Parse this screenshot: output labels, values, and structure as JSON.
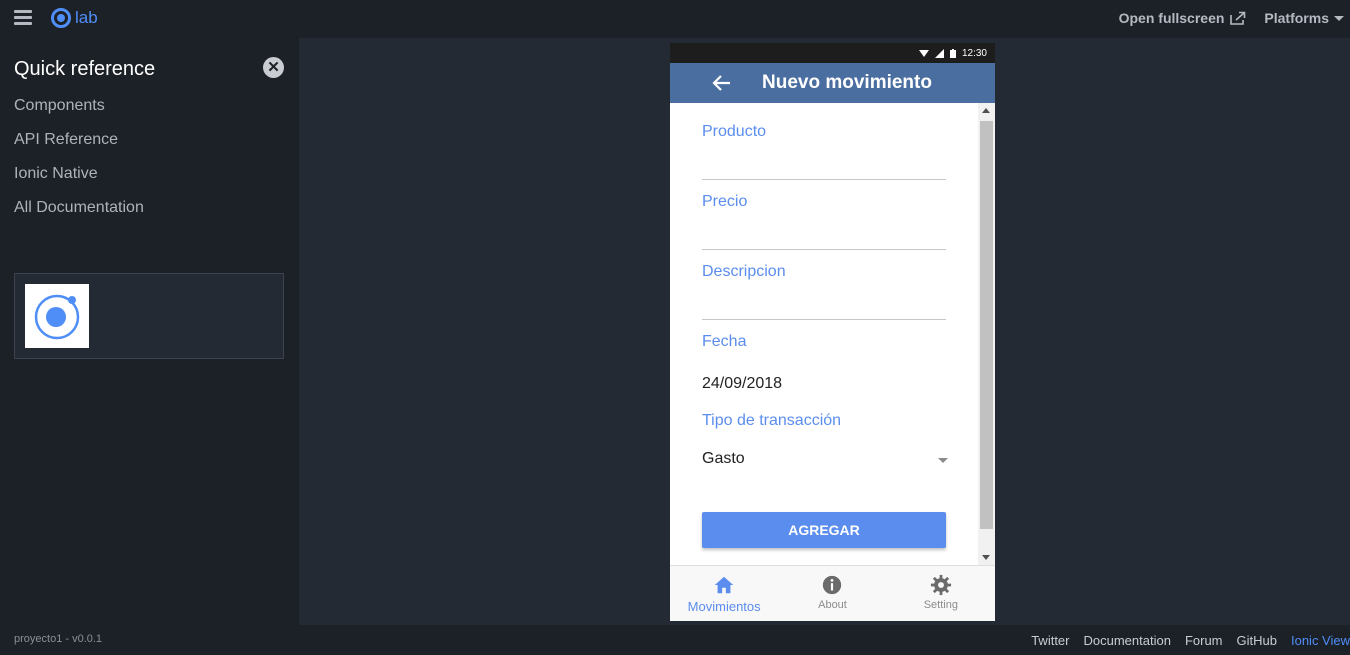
{
  "topbar": {
    "logo_text": "lab",
    "open_fullscreen": "Open fullscreen",
    "platforms": "Platforms"
  },
  "sidebar": {
    "title": "Quick reference",
    "close_glyph": "✕",
    "links": [
      "Components",
      "API Reference",
      "Ionic Native",
      "All Documentation"
    ]
  },
  "phone": {
    "status_time": "12:30",
    "title": "Nuevo movimiento",
    "form": {
      "producto_label": "Producto",
      "precio_label": "Precio",
      "descripcion_label": "Descripcion",
      "fecha_label": "Fecha",
      "fecha_value": "24/09/2018",
      "tipo_label": "Tipo de transacción",
      "tipo_value": "Gasto",
      "submit_label": "AGREGAR"
    },
    "tabs": [
      {
        "label": "Movimientos",
        "icon": "home-icon",
        "active": true
      },
      {
        "label": "About",
        "icon": "info-icon",
        "active": false
      },
      {
        "label": "Setting",
        "icon": "gear-icon",
        "active": false
      }
    ]
  },
  "footer": {
    "version": "proyecto1 - v0.0.1",
    "links": [
      "Twitter",
      "Documentation",
      "Forum",
      "GitHub",
      "Ionic View"
    ]
  },
  "colors": {
    "accent": "#5b8dee",
    "toolbar": "#4b6ea0",
    "ionic_blue": "#4f8ef7",
    "dark_bg": "#1c2027",
    "canvas_bg": "#242a33"
  }
}
